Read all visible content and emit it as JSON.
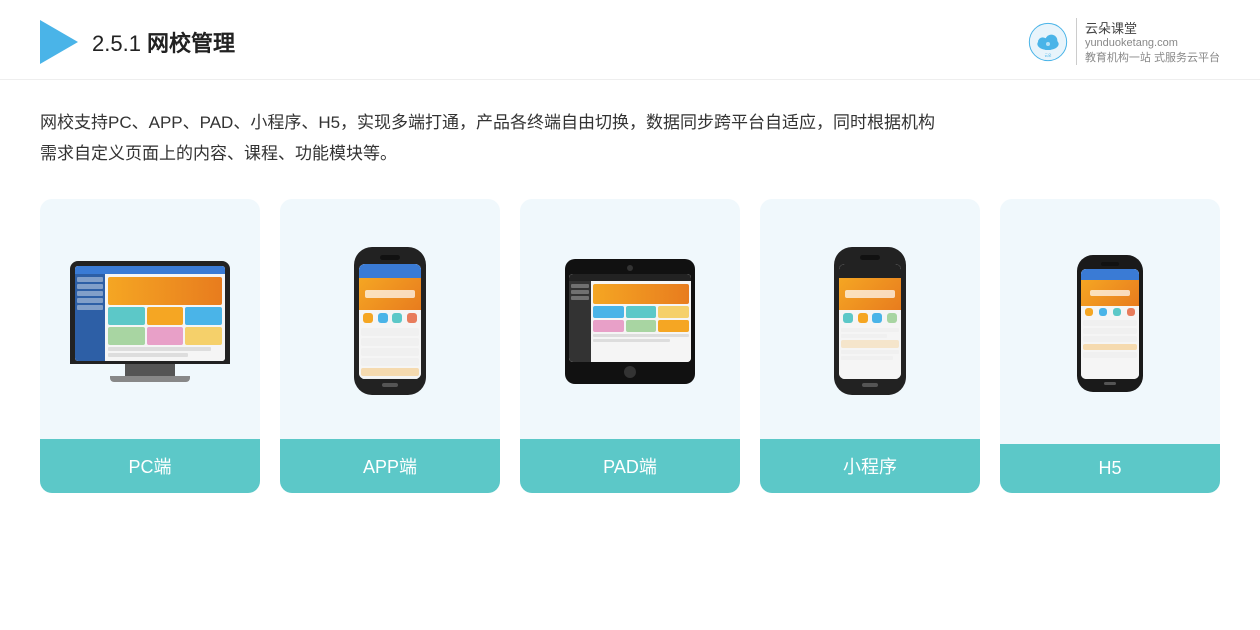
{
  "header": {
    "section_number": "2.5.1",
    "title_prefix": "2.5.1 ",
    "title_bold": "网校管理",
    "brand_name": "云朵课堂",
    "brand_url": "yunduoketang.com",
    "brand_tagline1": "教育机构一站",
    "brand_tagline2": "式服务云平台"
  },
  "description": {
    "line1": "网校支持PC、APP、PAD、小程序、H5，实现多端打通，产品各终端自由切换，数据同步跨平台自适应，同时根据机构",
    "line2": "需求自定义页面上的内容、课程、功能模块等。"
  },
  "cards": [
    {
      "id": "pc",
      "label": "PC端",
      "type": "pc"
    },
    {
      "id": "app",
      "label": "APP端",
      "type": "phone"
    },
    {
      "id": "pad",
      "label": "PAD端",
      "type": "tablet"
    },
    {
      "id": "miniprogram",
      "label": "小程序",
      "type": "phone"
    },
    {
      "id": "h5",
      "label": "H5",
      "type": "phone-sm"
    }
  ]
}
